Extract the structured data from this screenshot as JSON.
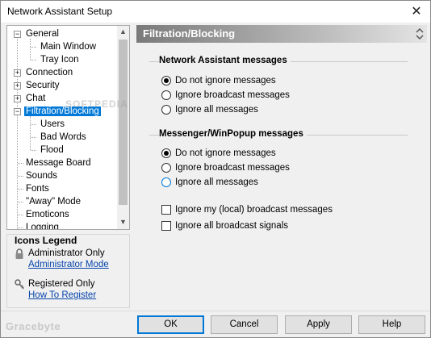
{
  "window": {
    "title": "Network Assistant Setup",
    "close_glyph": "✕"
  },
  "tree": {
    "items": [
      {
        "label": "General",
        "expander": "−"
      },
      {
        "label": "Main Window"
      },
      {
        "label": "Tray Icon"
      },
      {
        "label": "Connection",
        "expander": "+"
      },
      {
        "label": "Security",
        "expander": "+"
      },
      {
        "label": "Chat",
        "expander": "+"
      },
      {
        "label": "Filtration/Blocking",
        "expander": "−",
        "selected": true
      },
      {
        "label": "Users"
      },
      {
        "label": "Bad Words"
      },
      {
        "label": "Flood"
      },
      {
        "label": "Message Board"
      },
      {
        "label": "Sounds"
      },
      {
        "label": "Fonts"
      },
      {
        "label": "\"Away\" Mode"
      },
      {
        "label": "Emoticons"
      },
      {
        "label": "Logging"
      }
    ],
    "scroll_up": "▲",
    "scroll_down": "▼"
  },
  "legend": {
    "title": "Icons Legend",
    "admin_label": "Administrator Only",
    "admin_link": "Administrator Mode",
    "registered_label": "Registered Only",
    "registered_link": "How To Register"
  },
  "panel": {
    "title": "Filtration/Blocking",
    "groups": [
      {
        "title": "Network Assistant messages",
        "options": [
          "Do not ignore messages",
          "Ignore broadcast messages",
          "Ignore all messages"
        ],
        "selected": 0
      },
      {
        "title": "Messenger/WinPopup messages",
        "options": [
          "Do not ignore messages",
          "Ignore broadcast messages",
          "Ignore all messages"
        ],
        "selected": 0
      }
    ],
    "checkboxes": [
      {
        "label": "Ignore my (local) broadcast messages",
        "checked": false
      },
      {
        "label": "Ignore all broadcast signals",
        "checked": false
      }
    ]
  },
  "buttons": {
    "ok": "OK",
    "cancel": "Cancel",
    "apply": "Apply",
    "help": "Help"
  },
  "watermarks": {
    "bottom": "Gracebyte",
    "center": "SOFTPEDIA"
  },
  "colors": {
    "selection": "#0078d7",
    "link": "#0645ad"
  }
}
